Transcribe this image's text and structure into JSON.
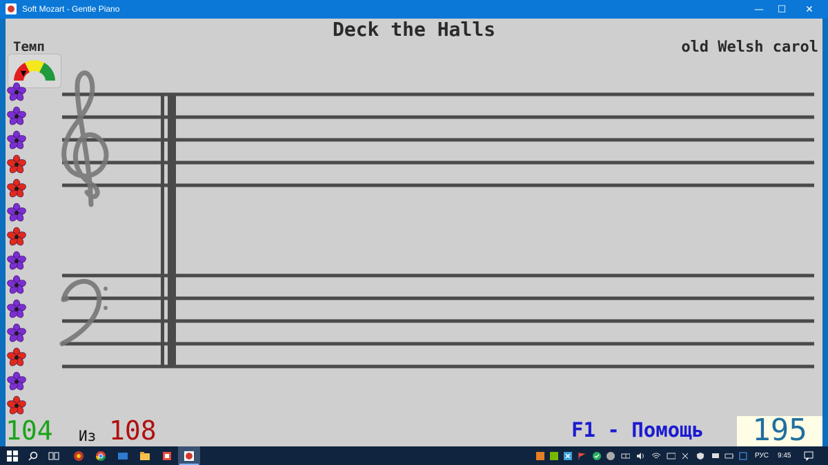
{
  "window": {
    "title": "Soft Mozart - Gentle Piano",
    "minimize_glyph": "—",
    "maximize_glyph": "☐",
    "close_glyph": "✕"
  },
  "song": {
    "title": "Deck the Halls",
    "composer": "old Welsh carol"
  },
  "tempo": {
    "label": "Темп",
    "gauge_colors": [
      "#e21e1e",
      "#f2e81d",
      "#1f9a3d"
    ],
    "needle_color": "#000000"
  },
  "flowers": [
    "purple",
    "purple",
    "purple",
    "red",
    "red",
    "purple",
    "red",
    "purple",
    "purple",
    "purple",
    "purple",
    "red",
    "purple",
    "red"
  ],
  "flower_colors": {
    "purple": "#7a2fd0",
    "red": "#e02a1a"
  },
  "progress": {
    "current": "104",
    "of_label": "Из",
    "total": "108"
  },
  "help": {
    "label": "F1 - Помощь"
  },
  "score": {
    "value": "195"
  },
  "taskbar": {
    "start_icon": "windows-start-icon",
    "language": "РУС",
    "time": "9:45"
  }
}
